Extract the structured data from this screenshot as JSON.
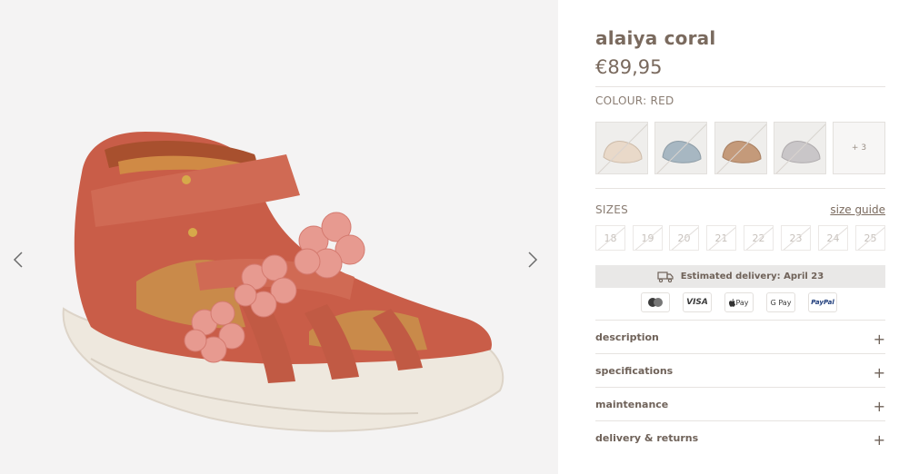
{
  "gallery": {
    "prev_label": "‹",
    "next_label": "›"
  },
  "product": {
    "title": "alaiya coral",
    "price": "€89,95",
    "colour_label": "COLOUR: RED"
  },
  "colours": {
    "more_label": "+ 3",
    "swatch_colors": [
      "#e9d9c9",
      "#a7b7c2",
      "#c49a7a",
      "#c9c6c8"
    ]
  },
  "sizes": {
    "label": "SIZES",
    "guide_label": "size guide",
    "values": [
      "18",
      "19",
      "20",
      "21",
      "22",
      "23",
      "24",
      "25"
    ]
  },
  "delivery": {
    "text": "Estimated delivery: April 23"
  },
  "payments": {
    "visa": "VISA",
    "applepay": "Pay",
    "gpay": "G Pay",
    "paypal": "PayPal"
  },
  "accordion": {
    "items": [
      {
        "label": "description"
      },
      {
        "label": "specifications"
      },
      {
        "label": "maintenance"
      },
      {
        "label": "delivery & returns"
      }
    ],
    "plus_label": "+"
  },
  "colors": {
    "accent_text": "#7a6a5e",
    "shoe_main": "#c95d48",
    "flower": "#e79a90"
  }
}
